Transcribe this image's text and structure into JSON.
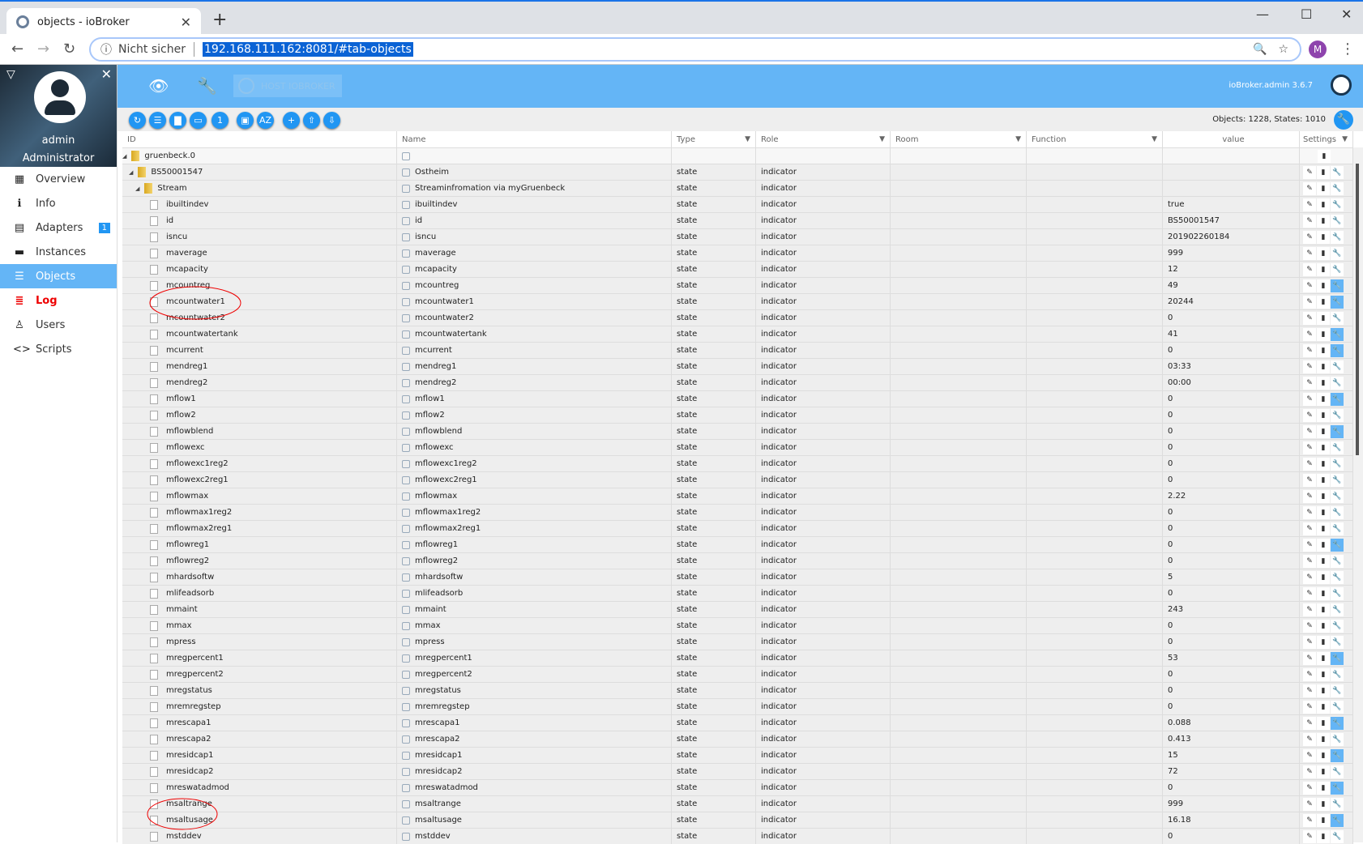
{
  "browser": {
    "tab_title": "objects - ioBroker",
    "security": "Nicht sicher",
    "url": "192.168.111.162:8081/#tab-objects",
    "profile": "M"
  },
  "sidebar": {
    "user": "admin",
    "role": "Administrator",
    "items": [
      {
        "label": "Overview",
        "icon": "grid-icon"
      },
      {
        "label": "Info",
        "icon": "info-icon"
      },
      {
        "label": "Adapters",
        "icon": "store-icon",
        "badge": "1"
      },
      {
        "label": "Instances",
        "icon": "instances-icon"
      },
      {
        "label": "Objects",
        "icon": "list-icon",
        "active": true
      },
      {
        "label": "Log",
        "icon": "log-icon"
      },
      {
        "label": "Users",
        "icon": "user-icon"
      },
      {
        "label": "Scripts",
        "icon": "code-icon"
      }
    ]
  },
  "header": {
    "host": "HOST IOBROKER",
    "version": "ioBroker.admin 3.6.7"
  },
  "toolbar": {
    "counts": "Objects: 1228, States: 1010"
  },
  "columns": [
    "ID",
    "Name",
    "Type",
    "Role",
    "Room",
    "Function",
    "value",
    "Settings"
  ],
  "colors": {
    "accent": "#64b5f6",
    "button": "#2196f3",
    "log": "#e00000",
    "annotation": "#e00000"
  },
  "rows": [
    {
      "id": "gruenbeck.0",
      "level": 0,
      "folder": true,
      "name": "",
      "type": "",
      "role": "",
      "value": "",
      "top": true
    },
    {
      "id": "BS50001547",
      "level": 1,
      "folder": true,
      "name": "Ostheim",
      "type": "state",
      "role": "indicator",
      "value": ""
    },
    {
      "id": "Stream",
      "level": 2,
      "folder": true,
      "name": "Streaminfromation via myGruenbeck",
      "type": "state",
      "role": "indicator",
      "value": ""
    },
    {
      "id": "ibuiltindev",
      "value": "true"
    },
    {
      "id": "id",
      "value": "BS50001547"
    },
    {
      "id": "isncu",
      "value": "201902260184"
    },
    {
      "id": "maverage",
      "value": "999"
    },
    {
      "id": "mcapacity",
      "value": "12"
    },
    {
      "id": "mcountreg",
      "value": "49",
      "hl": true
    },
    {
      "id": "mcountwater1",
      "value": "20244",
      "hl": true
    },
    {
      "id": "mcountwater2",
      "value": "0"
    },
    {
      "id": "mcountwatertank",
      "value": "41",
      "hl": true
    },
    {
      "id": "mcurrent",
      "value": "0",
      "hl": true
    },
    {
      "id": "mendreg1",
      "value": "03:33"
    },
    {
      "id": "mendreg2",
      "value": "00:00"
    },
    {
      "id": "mflow1",
      "value": "0",
      "hl": true
    },
    {
      "id": "mflow2",
      "value": "0"
    },
    {
      "id": "mflowblend",
      "value": "0",
      "hl": true
    },
    {
      "id": "mflowexc",
      "value": "0"
    },
    {
      "id": "mflowexc1reg2",
      "value": "0"
    },
    {
      "id": "mflowexc2reg1",
      "value": "0"
    },
    {
      "id": "mflowmax",
      "value": "2.22"
    },
    {
      "id": "mflowmax1reg2",
      "value": "0"
    },
    {
      "id": "mflowmax2reg1",
      "value": "0"
    },
    {
      "id": "mflowreg1",
      "value": "0",
      "hl": true
    },
    {
      "id": "mflowreg2",
      "value": "0"
    },
    {
      "id": "mhardsoftw",
      "value": "5"
    },
    {
      "id": "mlifeadsorb",
      "value": "0"
    },
    {
      "id": "mmaint",
      "value": "243"
    },
    {
      "id": "mmax",
      "value": "0"
    },
    {
      "id": "mpress",
      "value": "0"
    },
    {
      "id": "mregpercent1",
      "value": "53",
      "hl": true
    },
    {
      "id": "mregpercent2",
      "value": "0"
    },
    {
      "id": "mregstatus",
      "value": "0"
    },
    {
      "id": "mremregstep",
      "value": "0"
    },
    {
      "id": "mrescapa1",
      "value": "0.088",
      "hl": true
    },
    {
      "id": "mrescapa2",
      "value": "0.413"
    },
    {
      "id": "mresidcap1",
      "value": "15",
      "hl": true
    },
    {
      "id": "mresidcap2",
      "value": "72"
    },
    {
      "id": "mreswatadmod",
      "value": "0",
      "hl": true
    },
    {
      "id": "msaltrange",
      "value": "999"
    },
    {
      "id": "msaltusage",
      "value": "16.18",
      "hl": true
    },
    {
      "id": "mstddev",
      "value": "0"
    }
  ],
  "state_defaults": {
    "type": "state",
    "role": "indicator"
  }
}
